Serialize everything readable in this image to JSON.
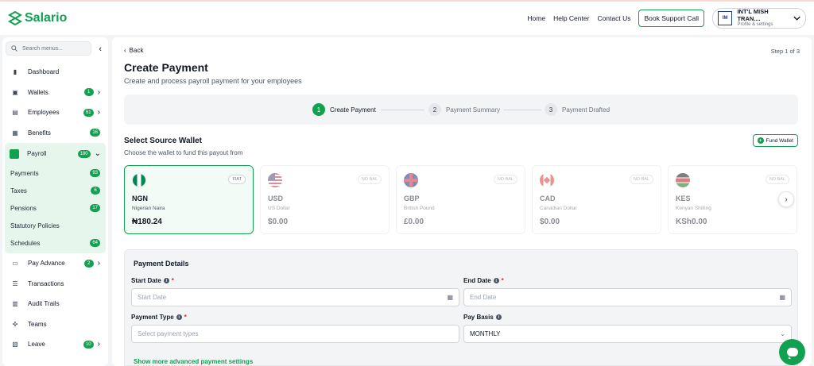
{
  "app": {
    "name": "Salario"
  },
  "topnav": {
    "home": "Home",
    "help": "Help Center",
    "contact": "Contact Us",
    "support": "Book Support Call"
  },
  "profile": {
    "logo": "IM",
    "name": "INT'L MISH TRAN....",
    "sub": "Profile & settings"
  },
  "sidebar": {
    "search_placeholder": "Search menus...",
    "items_top": [
      {
        "label": "Dashboard",
        "icon": "chart-icon"
      },
      {
        "label": "Wallets",
        "badge": "1",
        "icon": "wallet-icon"
      },
      {
        "label": "Employees",
        "badge": "61",
        "icon": "users-icon"
      },
      {
        "label": "Benefits",
        "badge": "16",
        "icon": "gift-icon"
      }
    ],
    "payroll": {
      "label": "Payroll",
      "badge": "180"
    },
    "payroll_sub": [
      {
        "label": "Payments",
        "badge": "93"
      },
      {
        "label": "Taxes",
        "badge": "6"
      },
      {
        "label": "Pensions",
        "badge": "17"
      },
      {
        "label": "Statutory Policies"
      },
      {
        "label": "Schedules",
        "badge": "64"
      }
    ],
    "items_bottom": [
      {
        "label": "Pay Advance",
        "badge": "2",
        "icon": "card-icon"
      },
      {
        "label": "Transactions",
        "icon": "list-icon"
      },
      {
        "label": "Audit Trails",
        "icon": "document-icon"
      },
      {
        "label": "Teams",
        "icon": "team-icon"
      },
      {
        "label": "Leave",
        "badge": "10",
        "icon": "calendar-icon"
      }
    ]
  },
  "page": {
    "back": "Back",
    "step_of": "Step 1 of 3",
    "title": "Create Payment",
    "subtitle": "Create and process payroll payment for your employees"
  },
  "stepper": [
    {
      "num": "1",
      "label": "Create Payment"
    },
    {
      "num": "2",
      "label": "Payment Summary"
    },
    {
      "num": "3",
      "label": "Payment Drafted"
    }
  ],
  "wallets_section": {
    "title": "Select Source Wallet",
    "subtitle": "Choose the wallet to fund this payout from",
    "fund_button": "Fund Wallet"
  },
  "wallets": [
    {
      "code": "NGN",
      "name": "Nigerian Naira",
      "balance": "₦180.24",
      "tag": "FIAT"
    },
    {
      "code": "USD",
      "name": "US Dollar",
      "balance": "$0.00",
      "tag": "NO BAL"
    },
    {
      "code": "GBP",
      "name": "British Pound",
      "balance": "£0.00",
      "tag": "NO BAL"
    },
    {
      "code": "CAD",
      "name": "Canadian Dollar",
      "balance": "$0.00",
      "tag": "NO BAL"
    },
    {
      "code": "KES",
      "name": "Kenyan Shilling",
      "balance": "KSh0.00",
      "tag": "NO BAL"
    }
  ],
  "payment_details": {
    "title": "Payment Details",
    "start_date": {
      "label": "Start Date",
      "placeholder": "Start Date"
    },
    "end_date": {
      "label": "End Date",
      "placeholder": "End Date"
    },
    "payment_type": {
      "label": "Payment Type",
      "placeholder": "Select payment types"
    },
    "pay_basis": {
      "label": "Pay Basis",
      "value": "MONTHLY"
    },
    "advanced_link": "Show more advanced payment settings"
  },
  "colors": {
    "brand": "#12a150"
  }
}
